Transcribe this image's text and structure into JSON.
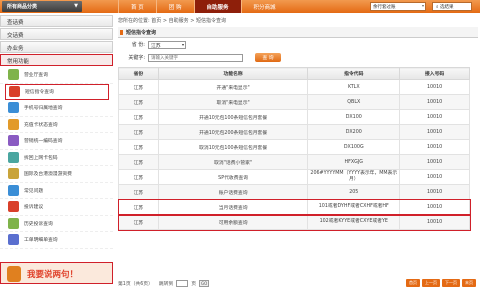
{
  "topbar": {
    "category_button": "所有商品分类",
    "nav": [
      "首 页",
      "团 购",
      "自助服务",
      "积分商城"
    ],
    "active_nav": 2,
    "select_label": "余行套过账",
    "search_label": "选结果"
  },
  "sidebar": {
    "sections": [
      "查话费",
      "交话费",
      "办业务",
      "常用功能"
    ],
    "items": [
      {
        "label": "营业厅查询",
        "color": "#7fb34a"
      },
      {
        "label": "短信指令查询",
        "color": "#d9402a"
      },
      {
        "label": "手机号归属地查询",
        "color": "#3b8ed6"
      },
      {
        "label": "充值卡状态查询",
        "color": "#e29a2a"
      },
      {
        "label": "营销统一编码查询",
        "color": "#8a5bc2"
      },
      {
        "label": "拆回上网卡包码",
        "color": "#4aa6a0"
      },
      {
        "label": "国际及台港澳漫游资费",
        "color": "#c9a43a"
      },
      {
        "label": "常见问题",
        "color": "#3b8ed6"
      },
      {
        "label": "投诉建议",
        "color": "#d9402a"
      },
      {
        "label": "历史投诉查询",
        "color": "#7fb34a"
      },
      {
        "label": "工单明细单查询",
        "color": "#5a6fcf"
      }
    ],
    "promo_text": "我要说两句！"
  },
  "main": {
    "breadcrumb": "您所在的位置: 首页 > 自助服务 > 短信指令查询",
    "section_title": "短信指令查询",
    "province_label": "省 份:",
    "province_value": "江苏",
    "keyword_label": "关键字:",
    "keyword_placeholder": "请输入关键字",
    "search_button": "查 询",
    "table": {
      "headers": [
        "省份",
        "功能名称",
        "指令代码",
        "接入号码"
      ],
      "rows": [
        [
          "江苏",
          "开通\"来电显示\"",
          "KTLX",
          "10010"
        ],
        [
          "江苏",
          "取消\"来电显示\"",
          "QBLX",
          "10010"
        ],
        [
          "江苏",
          "开通10元包100条短信包月套餐",
          "DX100",
          "10010"
        ],
        [
          "江苏",
          "开通10元包200条短信包月套餐",
          "DX200",
          "10010"
        ],
        [
          "江苏",
          "取消10元包100条短信包月套餐",
          "DX100G",
          "10010"
        ],
        [
          "江苏",
          "取消\"话费小管家\"",
          "HFXGJG",
          "10010"
        ],
        [
          "江苏",
          "SP代收费查询",
          "206#YYYYMM（YYYY表示年，MM表示月）",
          "10010"
        ],
        [
          "江苏",
          "账户话费查询",
          "205",
          "10010"
        ],
        [
          "江苏",
          "当月话费查询",
          "101或者DYHF或者CXHF或者HF",
          "10010"
        ],
        [
          "江苏",
          "可用余额查询",
          "102或者KYYE或者CXYE或者YE",
          "10010"
        ]
      ]
    },
    "pager": {
      "page_info": "第1页（共6页）",
      "goto_label": "跳转到",
      "page_unit": "页",
      "go": "GO",
      "buttons": [
        "首页",
        "上一页",
        "下一页",
        "末页"
      ]
    }
  }
}
